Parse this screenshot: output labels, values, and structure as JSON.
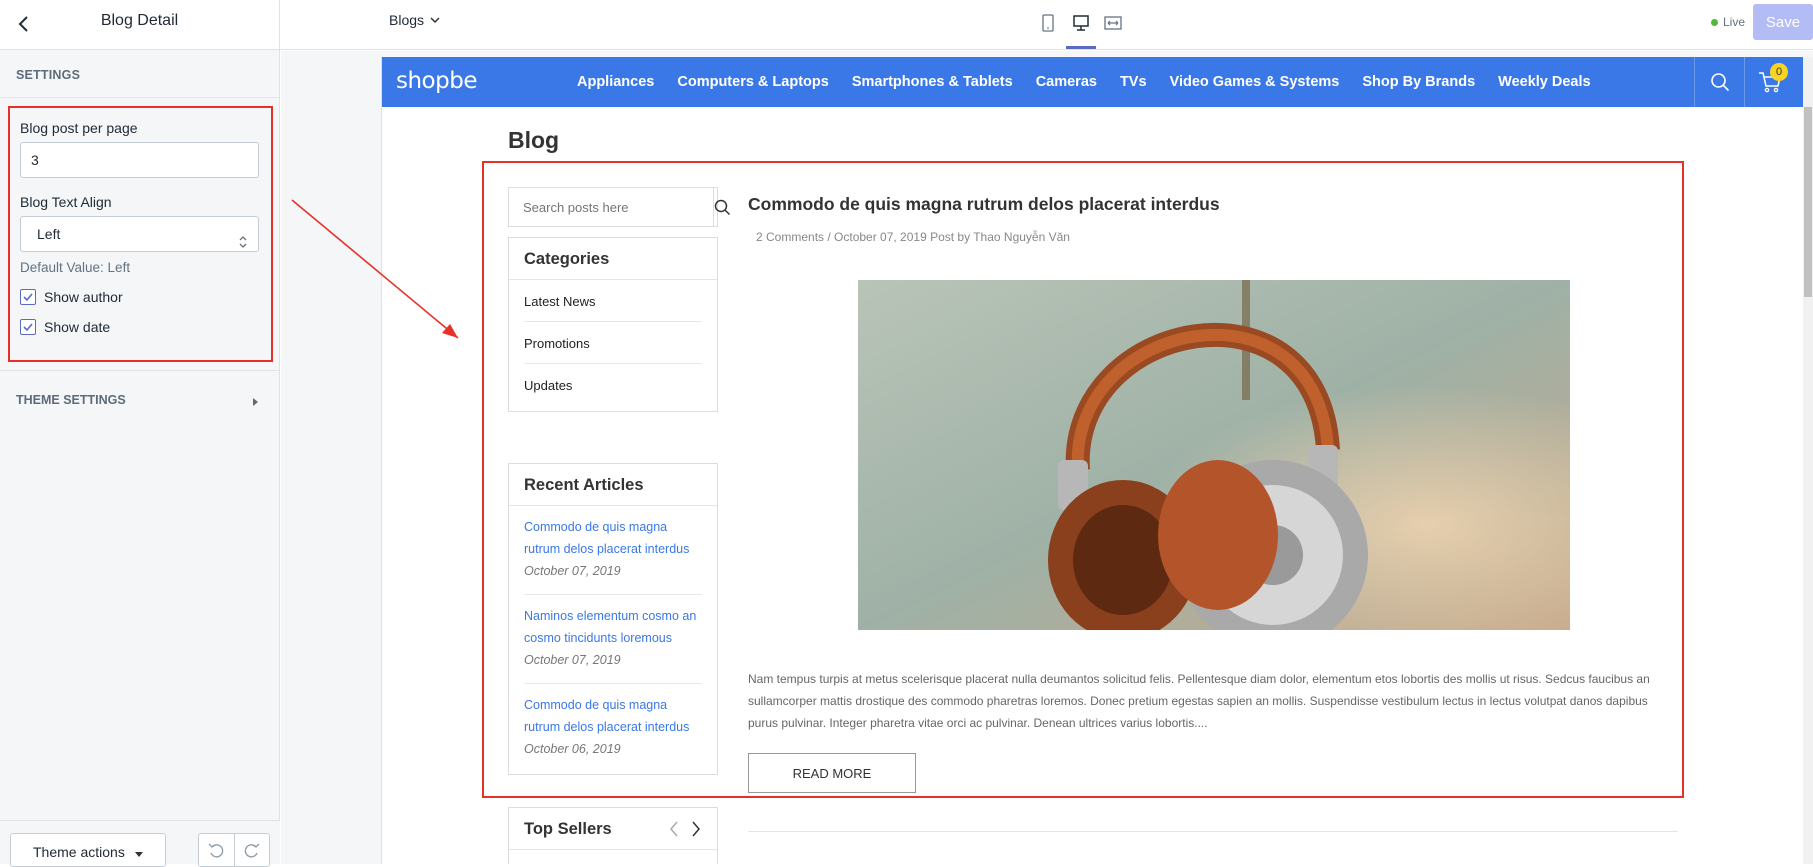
{
  "sidebar": {
    "title": "Blog Detail",
    "settings_heading": "SETTINGS",
    "fields": {
      "per_page_label": "Blog post per page",
      "per_page_value": "3",
      "align_label": "Blog Text Align",
      "align_value": "Left",
      "align_hint": "Default Value: Left",
      "show_author_label": "Show author",
      "show_author_checked": true,
      "show_date_label": "Show date",
      "show_date_checked": true
    },
    "theme_settings": "THEME SETTINGS",
    "theme_actions": "Theme actions"
  },
  "topbar": {
    "page_select": "Blogs",
    "devices": [
      "mobile-icon",
      "desktop-icon",
      "fullwidth-icon"
    ],
    "active_device": "desktop-icon",
    "live_label": "Live",
    "save_label": "Save"
  },
  "store": {
    "logo": "shopbe",
    "nav": [
      "Appliances",
      "Computers & Laptops",
      "Smartphones & Tablets",
      "Cameras",
      "TVs",
      "Video Games & Systems",
      "Shop By Brands",
      "Weekly Deals"
    ],
    "cart_count": "0",
    "brand_color": "#3b78e7"
  },
  "blog": {
    "heading": "Blog",
    "search_placeholder": "Search posts here",
    "categories_title": "Categories",
    "categories": [
      "Latest News",
      "Promotions",
      "Updates"
    ],
    "recent_title": "Recent Articles",
    "recent": [
      {
        "title": "Commodo de quis magna rutrum delos placerat interdus",
        "date": "October 07, 2019"
      },
      {
        "title": "Naminos elementum cosmo an cosmo tincidunts loremous",
        "date": "October 07, 2019"
      },
      {
        "title": "Commodo de quis magna rutrum delos placerat interdus",
        "date": "October 06, 2019"
      }
    ],
    "post": {
      "title": "Commodo de quis magna rutrum delos placerat interdus",
      "meta": "2 Comments / October 07, 2019 Post by Thao Nguyễn Văn",
      "excerpt": "Nam tempus turpis at metus scelerisque placerat nulla deumantos solicitud felis. Pellentesque diam dolor, elementum etos lobortis des mollis ut risus. Sedcus faucibus an sullamcorper mattis drostique des commodo pharetras loremos. Donec pretium egestas sapien an mollis. Suspendisse vestibulum lectus in lectus volutpat danos dapibus purus pulvinar. Integer pharetra vitae orci ac pulvinar. Denean ultrices varius lobortis....",
      "read_more": "READ MORE"
    },
    "top_sellers_title": "Top Sellers"
  },
  "annotation_color": "#e8302a"
}
